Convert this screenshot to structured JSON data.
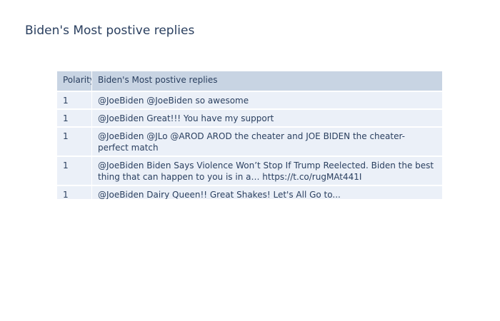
{
  "chart_data": {
    "type": "table",
    "title": "Biden's Most postive replies",
    "columns": [
      "Polarity",
      "Biden's Most postive replies"
    ],
    "rows": [
      {
        "polarity": "1",
        "reply": "@JoeBiden @JoeBiden so awesome"
      },
      {
        "polarity": "1",
        "reply": "@JoeBiden Great!!! You have my support"
      },
      {
        "polarity": "1",
        "reply": "@JoeBiden @JLo @AROD AROD the cheater and JOE BIDEN the cheater- perfect match"
      },
      {
        "polarity": "1",
        "reply": "@JoeBiden  Biden Says Violence Won’t Stop If Trump Reelected.  Biden the best thing that can happen to you is in a… https://t.co/rugMAt441I"
      },
      {
        "polarity": "1",
        "reply": "@JoeBiden Dairy Queen!! Great Shakes! Let's All Go to..."
      }
    ],
    "colors": {
      "header_fill": "#c8d4e3",
      "cell_fill": "#ebf0f8",
      "text": "#2a3f5f",
      "line": "#ffffff"
    }
  }
}
